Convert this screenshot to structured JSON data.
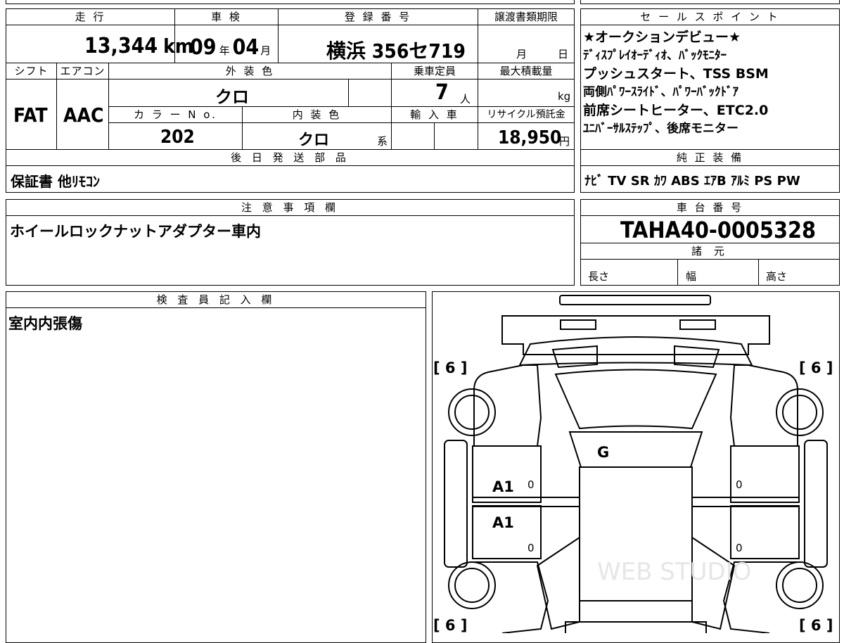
{
  "labels": {
    "mileage": "走 行",
    "inspection": "車 検",
    "registration": "登 録 番 号",
    "transfer_deadline": "譲渡書類期限",
    "sales_points": "セ ー ル ス ポ イ ン ト",
    "shift": "シフト",
    "aircon": "エアコン",
    "exterior_color": "外 装 色",
    "capacity": "乗車定員",
    "max_load": "最大積載量",
    "color_no": "カ ラ ー N o.",
    "interior_color": "内 装 色",
    "import": "輸 入 車",
    "recycle_fee": "リサイクル預託金",
    "later_parts": "後 日 発 送 部 品",
    "genuine_equipment": "純 正 装 備",
    "notes": "注 意 事 項 欄",
    "chassis_number": "車 台 番 号",
    "specs": "諸 元",
    "inspector": "検 査 員 記 入 欄"
  },
  "vehicle": {
    "mileage": "13,344",
    "mileage_unit": "km",
    "inspection_year": "09",
    "year_unit": "年",
    "inspection_month": "04",
    "month_unit": "月",
    "plate": "横浜 356セ719",
    "deadline_month": "月",
    "deadline_day": "日",
    "shift": "FAT",
    "aircon": "AAC",
    "exterior_color": "クロ",
    "capacity": "7",
    "capacity_unit": "人",
    "load_unit": "kg",
    "color_no": "202",
    "interior_color": "クロ",
    "interior_suffix": "系",
    "recycle_fee": "18,950",
    "yen_unit": "円",
    "chassis_number": "TAHA40-0005328"
  },
  "sales_points": [
    "★オークションデビュー★",
    "ﾃﾞｨｽﾌﾟﾚｲｵｰﾃﾞｨｵ、ﾊﾞｯｸﾓﾆﾀｰ",
    "プッシュスタート、TSS BSM",
    "両側ﾊﾟﾜｰｽﾗｲﾄﾞ、ﾊﾟﾜｰﾊﾞｯｸﾄﾞｱ",
    "前席シートヒーター、ETC2.0",
    "ﾕﾆﾊﾞｰｻﾙｽﾃｯﾌﾟ、後席モニター"
  ],
  "later_parts": "保証書 他ﾘﾓｺﾝ",
  "genuine_equipment": "ﾅﾋﾞ TV SR ｶﾜ ABS ｴｱB ｱﾙﾐ PS PW",
  "notes": "ホイールロックナットアダプター車内",
  "specs": {
    "length": "長さ",
    "width": "幅",
    "height": "高さ"
  },
  "inspector_note": "室内内張傷",
  "diagram": {
    "tire_fl": "[ 6 ]",
    "tire_fr": "[ 6 ]",
    "tire_rl": "[ 6 ]",
    "tire_rr": "[ 6 ]",
    "windshield_mark": "G",
    "front_door_mark": "A1",
    "rear_door_mark": "A1",
    "zero_1": "0",
    "zero_2": "0",
    "zero_3": "0",
    "zero_4": "0",
    "watermark": "WEB STUDIO"
  }
}
